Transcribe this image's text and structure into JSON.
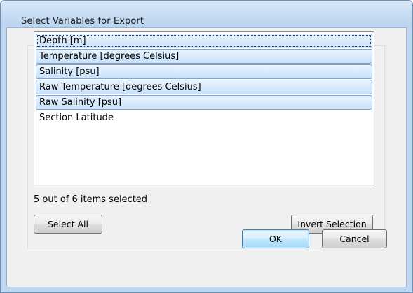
{
  "dialog": {
    "title": "Select Variables for Export"
  },
  "variables": {
    "items": [
      {
        "label": "Depth [m]",
        "selected": true,
        "focused": true
      },
      {
        "label": "Temperature [degrees Celsius]",
        "selected": true,
        "focused": false
      },
      {
        "label": "Salinity [psu]",
        "selected": true,
        "focused": false
      },
      {
        "label": "Raw Temperature [degrees Celsius]",
        "selected": true,
        "focused": false
      },
      {
        "label": "Raw Salinity [psu]",
        "selected": true,
        "focused": false
      },
      {
        "label": "Section Latitude",
        "selected": false,
        "focused": false
      }
    ],
    "status": "5 out of 6 items selected"
  },
  "buttons": {
    "select_all": "Select All",
    "invert_selection": "Invert Selection",
    "ok": "OK",
    "cancel": "Cancel"
  },
  "colors": {
    "selection": "#cfe3fb",
    "selection_border": "#7da2ce",
    "window_frame": "#bfd7f0",
    "default_button": "#bee6fd"
  }
}
